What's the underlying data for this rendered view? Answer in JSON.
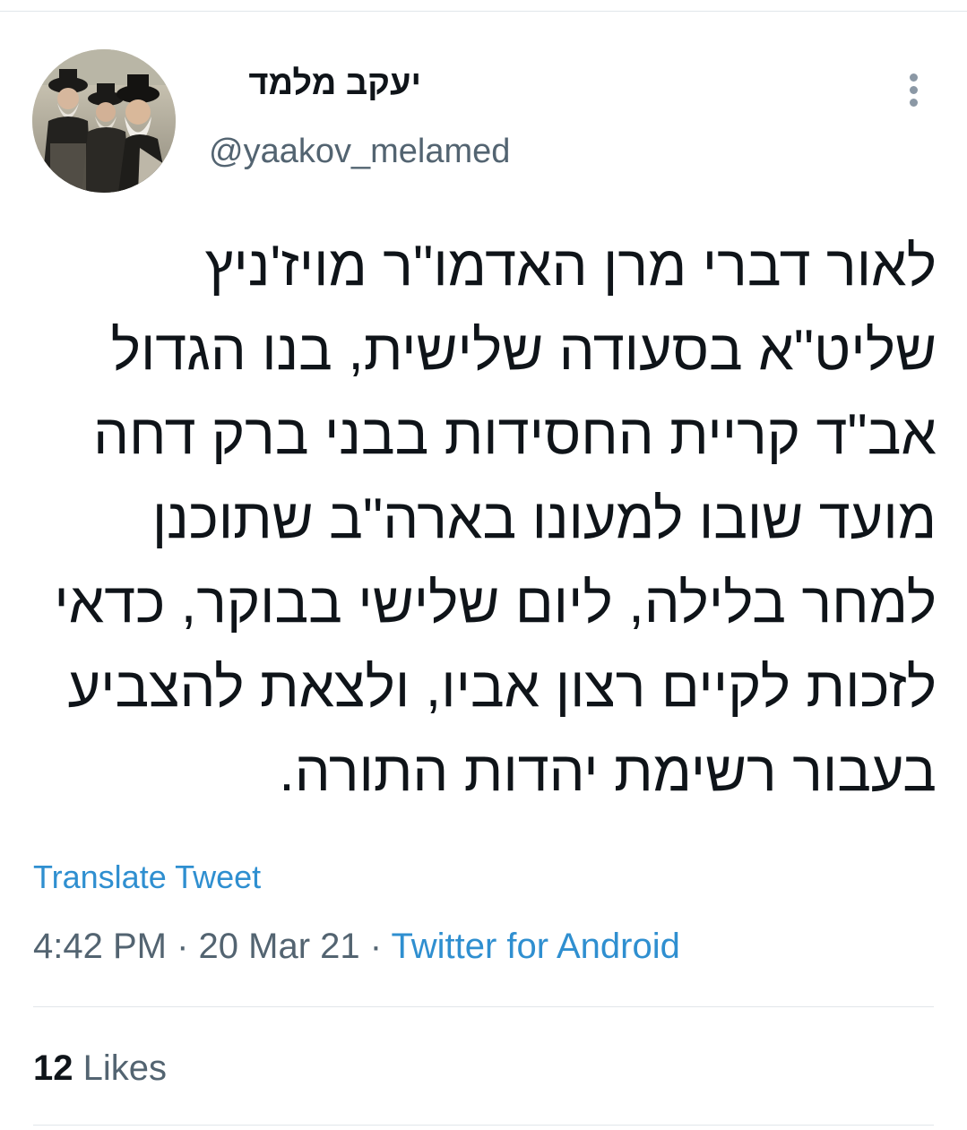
{
  "tweet": {
    "author": {
      "display_name": "יעקב מלמד",
      "handle": "@yaakov_melamed",
      "avatar_icon": "user-avatar-photo"
    },
    "more_icon": "more-vertical-icon",
    "text": "לאור דברי מרן האדמו\"ר מויז'ניץ\nשליט\"א בסעודה שלישית, בנו הגדול\nאב\"ד קריית החסידות בבני ברק דחה\nמועד שובו למעונו בארה\"ב שתוכנן\nלמחר בלילה, ליום שלישי בבוקר, כדאי\nלזכות לקיים רצון אביו, ולצאת להצביע\nבעבור רשימת יהדות התורה.",
    "translate_label": "Translate Tweet",
    "time": "4:42 PM",
    "separator": "·",
    "date": "20 Mar 21",
    "source": "Twitter for Android",
    "likes_count": "12",
    "likes_label": "Likes"
  },
  "colors": {
    "link": "#2f8fd0",
    "secondary_text": "#536471",
    "primary_text": "#0f1419",
    "divider": "#e1e6ea"
  }
}
